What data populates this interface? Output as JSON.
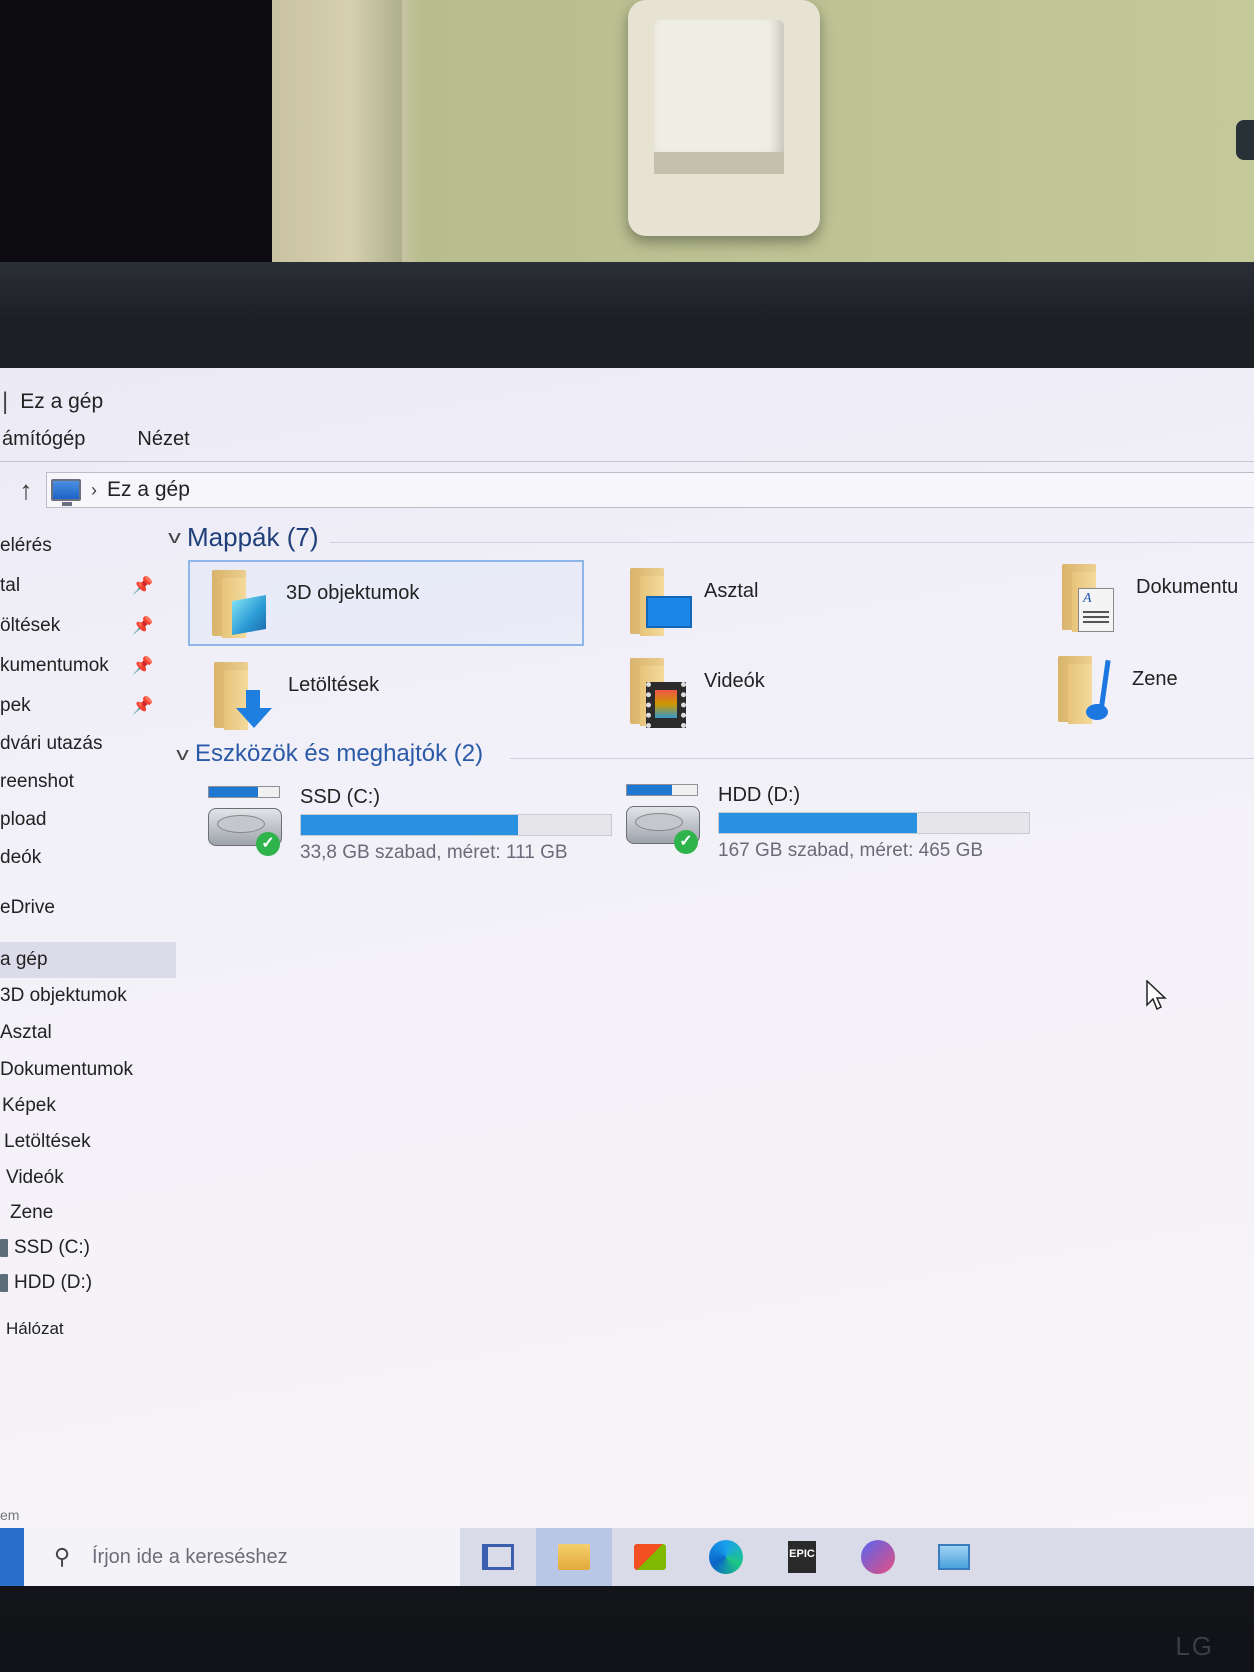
{
  "window": {
    "title": "Ez a gép"
  },
  "ribbon": {
    "tabs": [
      "ámítógép",
      "Nézet"
    ]
  },
  "address": {
    "path": "Ez a gép",
    "chevron": "›"
  },
  "nav": {
    "items": [
      {
        "label": "elérés",
        "pinned": false
      },
      {
        "label": "tal",
        "pinned": true
      },
      {
        "label": "öltések",
        "pinned": true
      },
      {
        "label": "kumentumok",
        "pinned": true
      },
      {
        "label": "pek",
        "pinned": true
      },
      {
        "label": "dvári utazás",
        "pinned": false
      },
      {
        "label": "reenshot",
        "pinned": false
      },
      {
        "label": "pload",
        "pinned": false
      },
      {
        "label": "deók",
        "pinned": false
      },
      {
        "label": "eDrive",
        "pinned": false
      },
      {
        "label": "a gép",
        "pinned": false,
        "selected": true
      },
      {
        "label": "3D objektumok",
        "pinned": false
      },
      {
        "label": "Asztal",
        "pinned": false
      },
      {
        "label": "Dokumentumok",
        "pinned": false
      },
      {
        "label": "Képek",
        "pinned": false
      },
      {
        "label": "Letöltések",
        "pinned": false
      },
      {
        "label": "Videók",
        "pinned": false
      },
      {
        "label": "Zene",
        "pinned": false
      },
      {
        "label": "SSD (C:)",
        "pinned": false,
        "drive": true
      },
      {
        "label": "HDD (D:)",
        "pinned": false,
        "drive": true
      },
      {
        "label": "Hálózat",
        "pinned": false
      }
    ],
    "status_fragment": "em"
  },
  "groups": {
    "folders_header": "Mappák (7)",
    "devices_header": "Eszközök és meghajtók (2)"
  },
  "folders": [
    {
      "name": "3D objektumok",
      "icon": "3d-objects-folder-icon",
      "selected": true
    },
    {
      "name": "Asztal",
      "icon": "desktop-folder-icon"
    },
    {
      "name": "Dokumentu",
      "icon": "documents-folder-icon"
    },
    {
      "name": "Letöltések",
      "icon": "downloads-folder-icon"
    },
    {
      "name": "Videók",
      "icon": "videos-folder-icon"
    },
    {
      "name": "Zene",
      "icon": "music-folder-icon"
    }
  ],
  "drives": [
    {
      "name": "SSD (C:)",
      "free_text": "33,8 GB szabad, méret: 111 GB",
      "used_fraction": 0.7
    },
    {
      "name": "HDD (D:)",
      "free_text": "167 GB szabad, méret: 465 GB",
      "used_fraction": 0.64
    }
  ],
  "taskbar": {
    "search_placeholder": "Írjon ide a kereséshez",
    "apps": [
      "task-view-icon",
      "file-explorer-icon",
      "microsoft-store-icon",
      "edge-icon",
      "epic-games-icon",
      "discord-icon",
      "control-panel-icon"
    ],
    "epic_label": "EPIC"
  },
  "bezel": {
    "brand": "LG"
  },
  "colors": {
    "accent_blue": "#2a90e0",
    "header_blue": "#1f3f7a",
    "ok_green": "#2fb44c"
  }
}
